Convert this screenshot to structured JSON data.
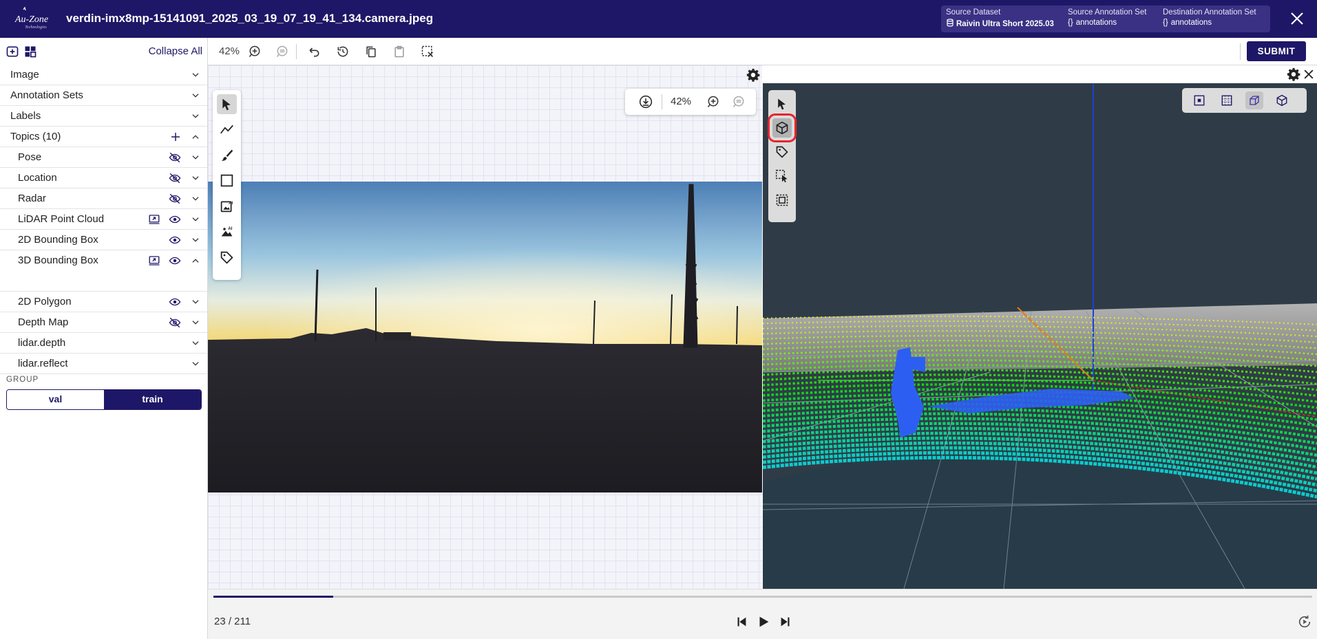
{
  "header": {
    "logo_text": "Au-Zone",
    "logo_subtext": "Technologies",
    "file_title": "verdin-imx8mp-15141091_2025_03_19_07_19_41_134.camera.jpeg",
    "source_dataset_label": "Source Dataset",
    "source_dataset_value": "Raivin Ultra Short 2025.03",
    "source_annotation_label": "Source Annotation Set",
    "source_annotation_value": "annotations",
    "dest_annotation_label": "Destination Annotation Set",
    "dest_annotation_value": "annotations",
    "braces": "{}"
  },
  "left_panel": {
    "collapse_all": "Collapse All",
    "sections": [
      {
        "label": "Image"
      },
      {
        "label": "Annotation Sets"
      },
      {
        "label": "Labels"
      },
      {
        "label": "Topics (10)"
      }
    ],
    "topics": [
      {
        "label": "Pose",
        "visibility": "hidden"
      },
      {
        "label": "Location",
        "visibility": "hidden"
      },
      {
        "label": "Radar",
        "visibility": "hidden"
      },
      {
        "label": "LiDAR Point Cloud",
        "visibility": "visible"
      },
      {
        "label": "2D Bounding Box",
        "visibility": "visible"
      },
      {
        "label": "3D Bounding Box",
        "visibility": "visible"
      },
      {
        "label": "2D Polygon",
        "visibility": "visible"
      },
      {
        "label": "Depth Map",
        "visibility": "hidden"
      },
      {
        "label": "lidar.depth"
      },
      {
        "label": "lidar.reflect"
      }
    ],
    "group_label": "GROUP",
    "group_options": [
      "val",
      "train"
    ],
    "group_selected": "train"
  },
  "toolbar": {
    "zoom": "42%",
    "submit": "SUBMIT"
  },
  "image_view": {
    "zoom": "42%"
  },
  "point_cloud_view": {
    "selected_tool": "3d-cuboid",
    "active_view": "perspective"
  },
  "timeline": {
    "current_frame": 23,
    "total_frames": 211,
    "counter": "23 / 211",
    "progress": 0.109
  },
  "colors": {
    "brand": "#1e1767",
    "highlight": "#e5262e",
    "pc_background": "#2f3c47"
  }
}
